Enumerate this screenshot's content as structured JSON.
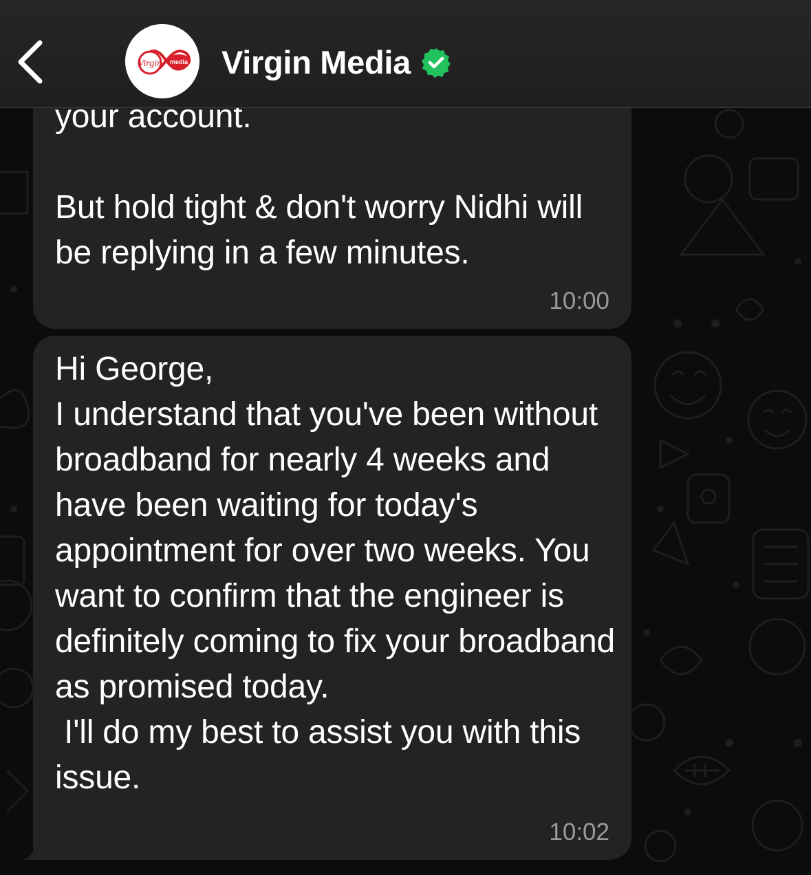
{
  "header": {
    "back_icon": "chevron-left-icon",
    "avatar_icon": "virgin-media-logo",
    "title": "Virgin Media",
    "verified_icon": "verified-badge-icon",
    "verified_color": "#22c35e"
  },
  "messages": [
    {
      "text": "your account.\n\nBut hold tight & don't worry Nidhi will be replying in a few minutes.",
      "time": "10:00"
    },
    {
      "text": "Hi George,\nI understand that you've been without broadband for nearly 4 weeks and have been waiting for today's appointment for over two weeks. You want to confirm that the engineer is definitely coming to fix your broadband as promised today.\n I'll do my best to assist you with this issue.",
      "time": "10:02"
    }
  ],
  "colors": {
    "background": "#0c0c0c",
    "header": "#232323",
    "bubble": "#232325",
    "text": "#ffffff",
    "timestamp": "#9a9a9a",
    "brand_red": "#d8202a"
  }
}
